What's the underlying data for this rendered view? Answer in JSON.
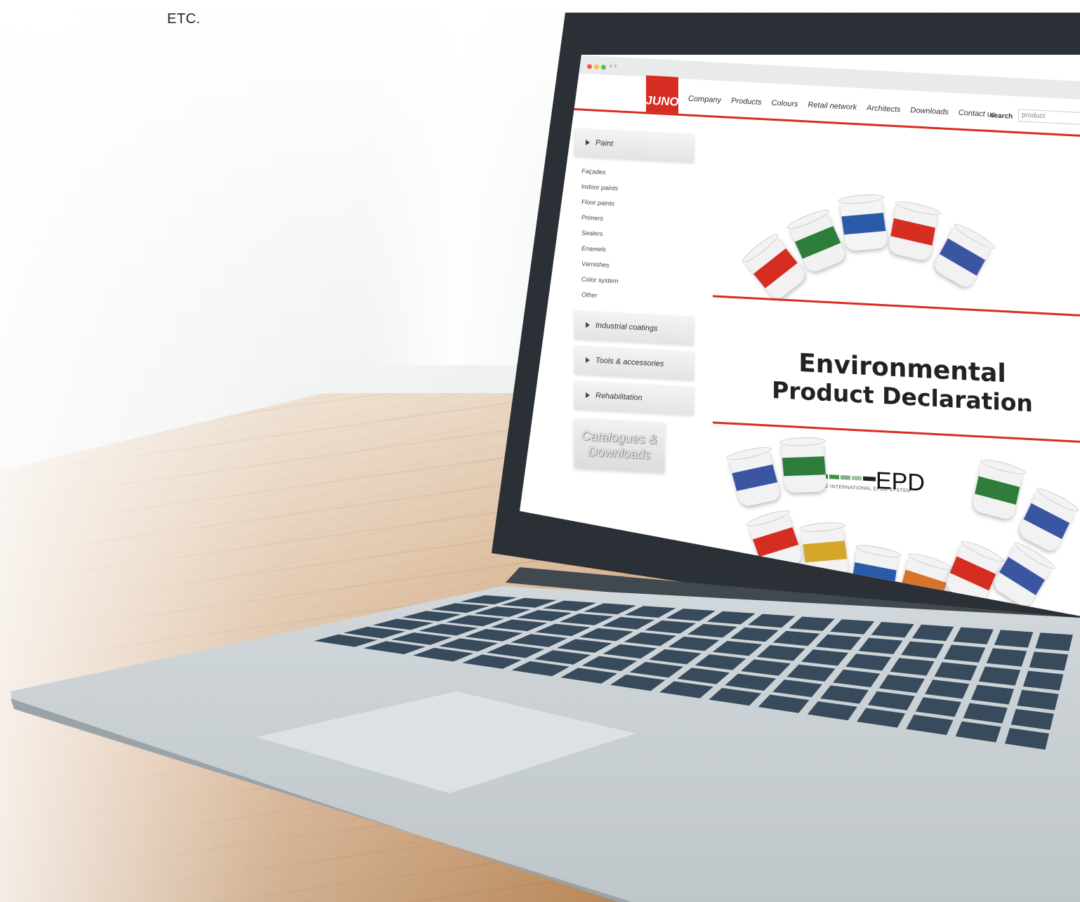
{
  "caption": "ETC.",
  "browser": {
    "nav_arrows": "‹ ›"
  },
  "header": {
    "logo": "JUNO",
    "nav": [
      "Company",
      "Products",
      "Colours",
      "Retail network",
      "Architects",
      "Downloads",
      "Contact us"
    ],
    "search_label": "search",
    "search_value": "product"
  },
  "sidebar": {
    "paint": {
      "label": "Paint",
      "items": [
        "Façades",
        "Indoor paints",
        "Floor paints",
        "Primers",
        "Sealers",
        "Enamels",
        "Varnishes",
        "Color system",
        "Other"
      ]
    },
    "industrial": "Industrial coatings",
    "tools": "Tools & accessories",
    "rehab": "Rehabilitation",
    "catalogue_line1": "Catalogues &",
    "catalogue_line2": "Downloads"
  },
  "banner": {
    "title_line1": "Environmental",
    "title_line2": "Product Declaration",
    "epd_logo": "EPD",
    "epd_sub": "THE INTERNATIONAL EPD® SYSTEM",
    "accent_color": "#d62d22"
  }
}
